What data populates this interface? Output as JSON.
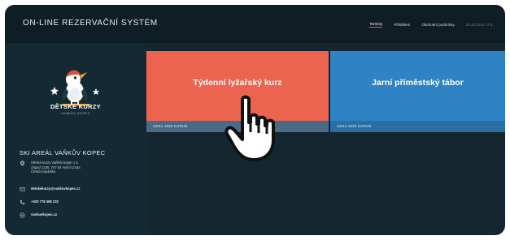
{
  "header": {
    "title": "ON-LINE REZERVAČNÍ SYSTÉM",
    "nav": [
      {
        "label": "Termíny",
        "active": true
      },
      {
        "label": "Přihlášení",
        "active": false
      },
      {
        "label": "Obchodní podmínky",
        "active": false
      }
    ],
    "date": "30.10.2019 17:5..."
  },
  "sidebar": {
    "logo_icon": "woodpecker-mascot",
    "logo_title": "DĚTSKÉ KURZY",
    "logo_subtitle": "VAŇKŮV KOPEC",
    "area_name": "SKI AREÁL VAŇKŮV KOPEC",
    "address": [
      "Dětské kurzy Vaňkův kopec z.s.",
      "Západ 1235, 747 64 Horní Lhota",
      "Česká republika"
    ],
    "email": "detskekurzy@vankuvkopec.cz",
    "phone": "+420 778 468 232",
    "website": "vankuvkopec.cz"
  },
  "tiles": [
    {
      "label": "Týdenní lyžařský kurz",
      "price": "CENA 1990 KORUN",
      "color": "#ec6450"
    },
    {
      "label": "Jarní příměstský tábor",
      "price": "CENA 3290 KORUN",
      "color": "#2f83c4"
    }
  ],
  "cursor_icon": "hand-pointer-icon"
}
